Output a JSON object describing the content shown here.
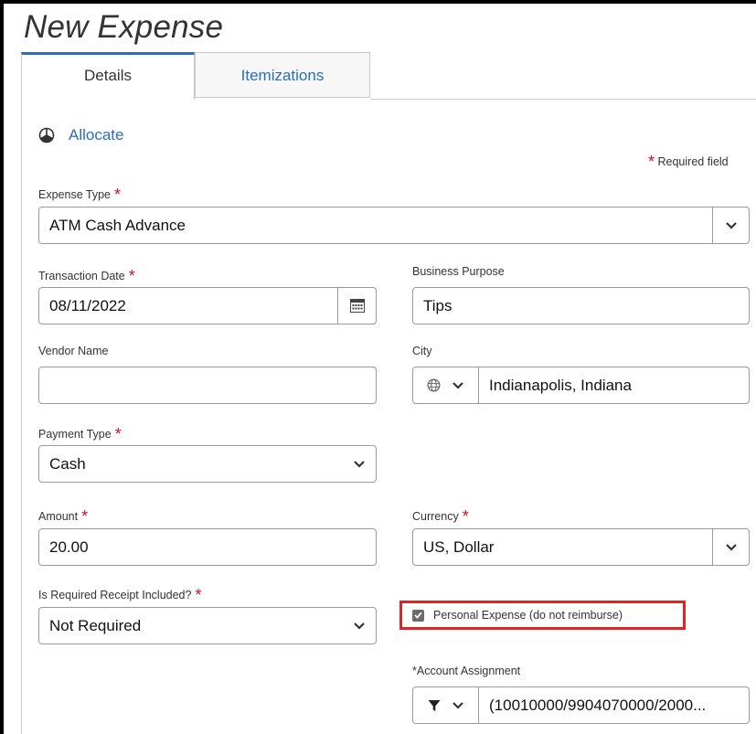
{
  "page": {
    "title": "New Expense"
  },
  "tabs": [
    {
      "label": "Details"
    },
    {
      "label": "Itemizations"
    }
  ],
  "allocate": {
    "label": "Allocate"
  },
  "required_note": {
    "star": "*",
    "text": "Required field"
  },
  "fields": {
    "expense_type": {
      "label": "Expense Type",
      "star": "*",
      "value": "ATM Cash Advance"
    },
    "transaction_date": {
      "label": "Transaction Date",
      "star": "*",
      "value": "08/11/2022"
    },
    "business_purpose": {
      "label": "Business Purpose",
      "value": "Tips"
    },
    "vendor_name": {
      "label": "Vendor Name",
      "value": ""
    },
    "city": {
      "label": "City",
      "value": "Indianapolis, Indiana"
    },
    "payment_type": {
      "label": "Payment Type",
      "star": "*",
      "value": "Cash"
    },
    "amount": {
      "label": "Amount",
      "star": "*",
      "value": "20.00"
    },
    "currency": {
      "label": "Currency",
      "star": "*",
      "value": "US, Dollar"
    },
    "receipt_included": {
      "label": "Is Required Receipt Included?",
      "star": "*",
      "value": "Not Required"
    },
    "personal_expense": {
      "label": "Personal Expense (do not reimburse)",
      "checked": true
    },
    "account_assignment": {
      "label": "*Account Assignment",
      "value": "(10010000/9904070000/2000..."
    }
  },
  "colors": {
    "link": "#2a6ebb",
    "required": "#c8102e",
    "highlight": "#e02424"
  }
}
